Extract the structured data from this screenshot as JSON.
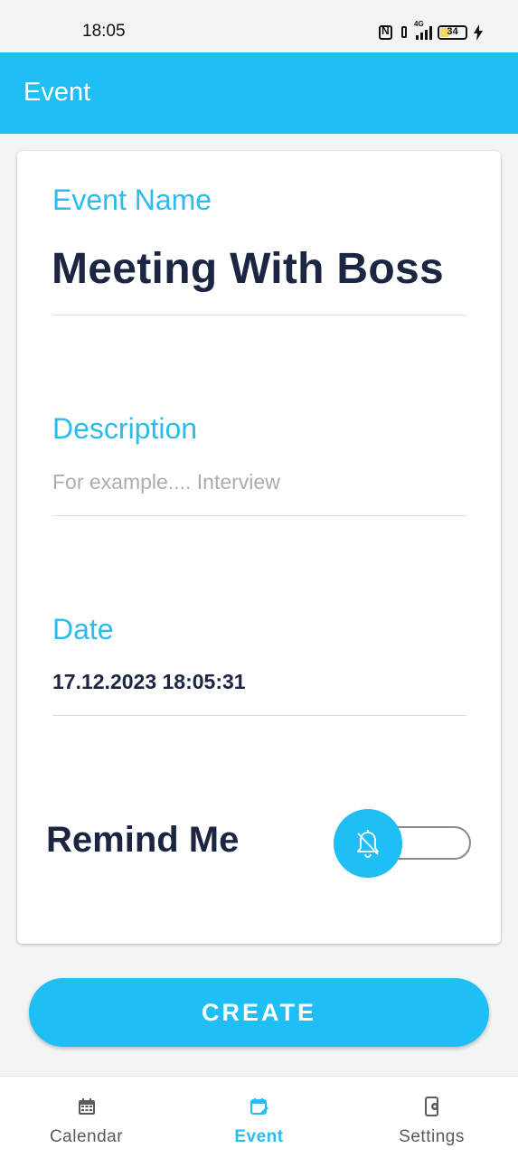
{
  "status_bar": {
    "time": "18:05",
    "network": "4G",
    "battery_level": "34",
    "icons": [
      "nfc-icon",
      "vibrate-icon",
      "signal-icon",
      "battery-icon",
      "charging-bolt-icon"
    ]
  },
  "app_bar": {
    "title": "Event"
  },
  "form": {
    "event_name": {
      "label": "Event Name",
      "value": "Meeting With Boss"
    },
    "description": {
      "label": "Description",
      "value": "",
      "placeholder": "For example.... Interview"
    },
    "date": {
      "label": "Date",
      "value": "17.12.2023 18:05:31"
    },
    "remind": {
      "label": "Remind Me",
      "enabled": false,
      "icon": "bell-off-icon"
    }
  },
  "create_label": "CREATE",
  "bottom_nav": {
    "items": [
      {
        "label": "Calendar",
        "icon": "calendar-icon",
        "active": false
      },
      {
        "label": "Event",
        "icon": "calendar-edit-icon",
        "active": true
      },
      {
        "label": "Settings",
        "icon": "phone-settings-icon",
        "active": false
      }
    ]
  },
  "colors": {
    "accent": "#1fbef5",
    "label": "#2bbcef",
    "text_dark": "#1c2541",
    "placeholder": "#a9adb3",
    "nav_inactive": "#5a5a5a"
  }
}
